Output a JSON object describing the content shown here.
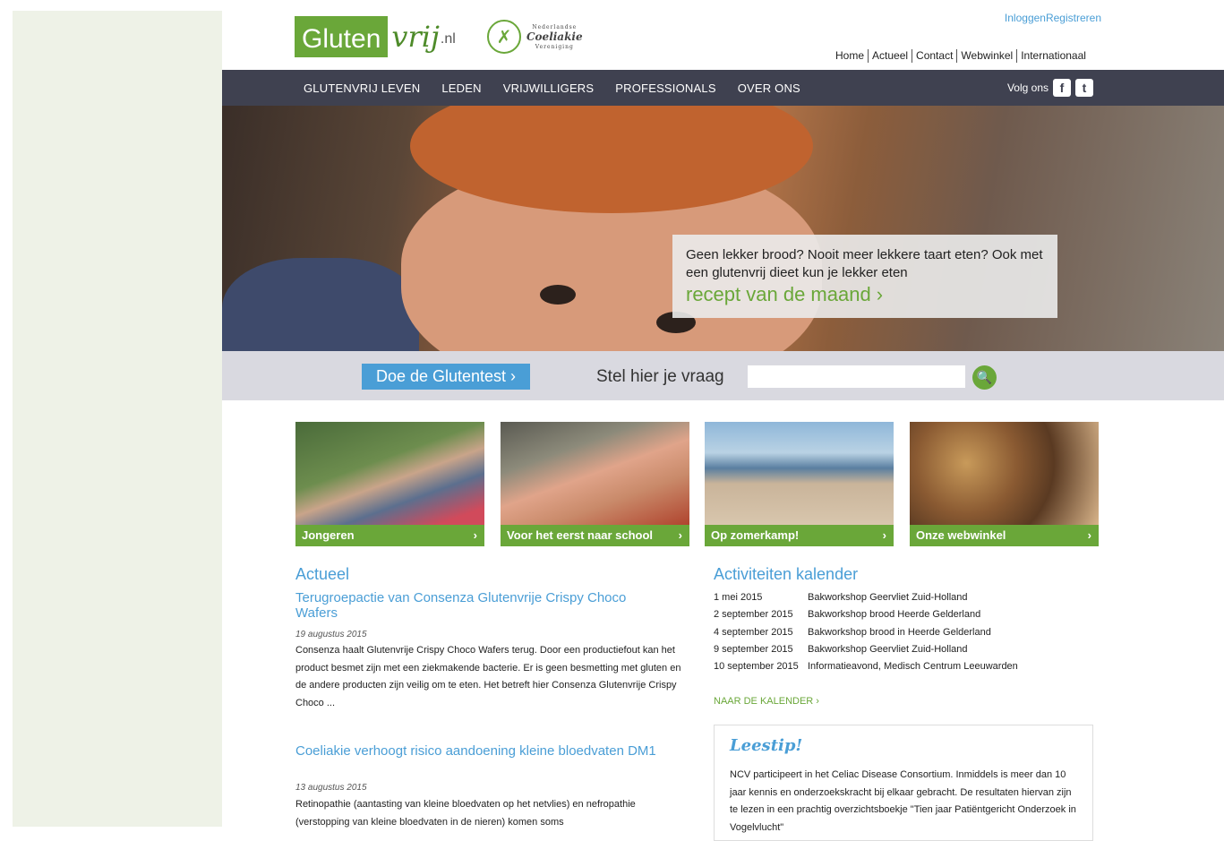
{
  "header": {
    "logo_main": "Gluten",
    "logo_script": "vrij",
    "logo_tld": ".nl",
    "partner_top": "Nederlandse",
    "partner_name": "Coeliakie",
    "partner_bottom": "Vereniging",
    "login": "Inloggen",
    "register": "Registreren",
    "top_nav": [
      "Home",
      "Actueel",
      "Contact",
      "Webwinkel",
      "Internationaal"
    ]
  },
  "main_nav": {
    "items": [
      "GLUTENVRIJ LEVEN",
      "LEDEN",
      "VRIJWILLIGERS",
      "PROFESSIONALS",
      "OVER ONS"
    ],
    "follow_label": "Volg ons",
    "facebook": "f",
    "twitter": "t"
  },
  "hero": {
    "text": "Geen lekker brood? Nooit meer lekkere taart eten? Ook met een glutenvrij dieet kun je lekker eten",
    "link": "recept van de maand ›"
  },
  "search": {
    "test_button": "Doe de Glutentest ›",
    "ask_label": "Stel hier je vraag",
    "placeholder": "",
    "button_glyph": "🔍"
  },
  "cards": [
    {
      "label": "Jongeren",
      "chev": "›"
    },
    {
      "label": "Voor het eerst naar school",
      "chev": "›"
    },
    {
      "label": "Op zomerkamp!",
      "chev": "›"
    },
    {
      "label": "Onze webwinkel",
      "chev": "›"
    }
  ],
  "news": {
    "section_title": "Actueel",
    "articles": [
      {
        "title": "Terugroepactie van Consenza Glutenvrije Crispy Choco Wafers",
        "date": "19 augustus 2015",
        "body": "Consenza haalt Glutenvrije Crispy Choco Wafers terug. Door een productiefout kan het product besmet zijn met een ziekmakende bacterie. Er is geen besmetting met gluten en de andere producten zijn veilig om te eten. Het betreft hier Consenza Glutenvrije Crispy Choco ..."
      },
      {
        "title": "Coeliakie verhoogt risico aandoening kleine bloedvaten DM1",
        "date": "13 augustus 2015",
        "body": "Retinopathie (aantasting van kleine bloedvaten op het netvlies) en nefropathie (verstopping van kleine bloedvaten in de nieren) komen soms"
      }
    ]
  },
  "calendar": {
    "section_title": "Activiteiten kalender",
    "rows": [
      {
        "date": "1 mei 2015",
        "event": "Bakworkshop Geervliet Zuid-Holland"
      },
      {
        "date": "2 september 2015",
        "event": "Bakworkshop brood Heerde Gelderland"
      },
      {
        "date": "4 september 2015",
        "event": "Bakworkshop brood in Heerde Gelderland"
      },
      {
        "date": "9 september 2015",
        "event": "Bakworkshop Geervliet Zuid-Holland"
      },
      {
        "date": "10 september 2015",
        "event": "Informatieavond, Medisch Centrum Leeuwarden"
      }
    ],
    "link": "NAAR DE KALENDER ›"
  },
  "leestip": {
    "title": "Leestip!",
    "body": "NCV participeert in het Celiac Disease Consortium. Inmiddels is meer dan 10 jaar kennis en onderzoekskracht bij elkaar gebracht. De resultaten hiervan zijn te lezen in een prachtig overzichtsboekje \"Tien jaar Patiëntgericht Onderzoek in Vogelvlucht\""
  },
  "colors": {
    "brand_green": "#6aa739",
    "link_blue": "#4a9ed6",
    "nav_dark": "#3f4150"
  }
}
